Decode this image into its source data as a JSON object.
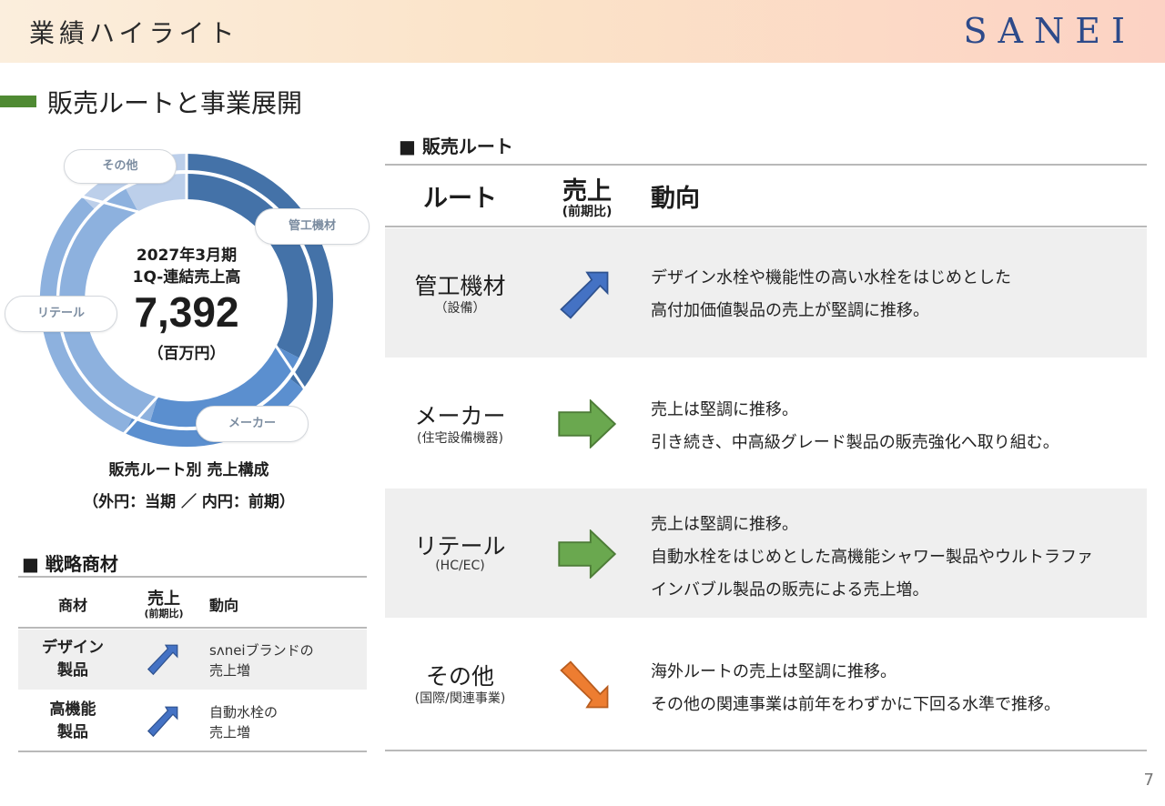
{
  "header": {
    "title": "業績ハイライト",
    "logo": "SANEI"
  },
  "section": {
    "title": "販売ルートと事業展開"
  },
  "composition": {
    "center_line1": "2027年3月期",
    "center_line2": "1Q-連結売上高",
    "center_value": "7,392",
    "center_unit": "（百万円）",
    "labels": {
      "kanko": "管工機材",
      "maker": "メーカー",
      "retail": "リテール",
      "other": "その他"
    },
    "caption_line1": "販売ルート別 売上構成",
    "caption_line2": "（外円：当期 ／ 内円：前期）",
    "colors": {
      "kanko": "#4472a8",
      "maker": "#5b8fcf",
      "retail": "#8db1de",
      "other": "#bccfea"
    }
  },
  "strategic": {
    "title": "■ 戦略商材",
    "headers": {
      "item": "商材",
      "sales": "売上",
      "sales_sub": "(前期比)",
      "trend": "動向"
    },
    "rows": [
      {
        "item_line1": "デザイン",
        "item_line2": "製品",
        "arrow": "up-right",
        "trend_line1": "sʌneiブランドの",
        "trend_line2": "売上増"
      },
      {
        "item_line1": "高機能",
        "item_line2": "製品",
        "arrow": "up-right",
        "trend_line1": "自動水栓の",
        "trend_line2": "売上増"
      }
    ]
  },
  "routes": {
    "title": "■ 販売ルート",
    "headers": {
      "route": "ルート",
      "sales": "売上",
      "sales_sub": "(前期比)",
      "trend": "動向"
    },
    "rows": [
      {
        "name": "管工機材",
        "sub": "（設備）",
        "arrow": "up-right",
        "arrow_color": "#4472c4",
        "trend": [
          "デザイン水栓や機能性の高い水栓をはじめとした",
          "高付加価値製品の売上が堅調に推移。"
        ]
      },
      {
        "name": "メーカー",
        "sub": "(住宅設備機器)",
        "arrow": "right",
        "arrow_color": "#6aa84f",
        "trend": [
          "売上は堅調に推移。",
          "引き続き、中高級グレード製品の販売強化へ取り組む。"
        ]
      },
      {
        "name": "リテール",
        "sub": "(HC/EC)",
        "arrow": "right",
        "arrow_color": "#6aa84f",
        "trend": [
          "売上は堅調に推移。",
          "自動水栓をはじめとした高機能シャワー製品やウルトラファ",
          "インバブル製品の販売による売上増。"
        ]
      },
      {
        "name": "その他",
        "sub": "(国際/関連事業)",
        "arrow": "down-right",
        "arrow_color": "#ed7d31",
        "trend": [
          "海外ルートの売上は堅調に推移。",
          "その他の関連事業は前年をわずかに下回る水準で推移。"
        ]
      }
    ]
  },
  "page_number": "7"
}
